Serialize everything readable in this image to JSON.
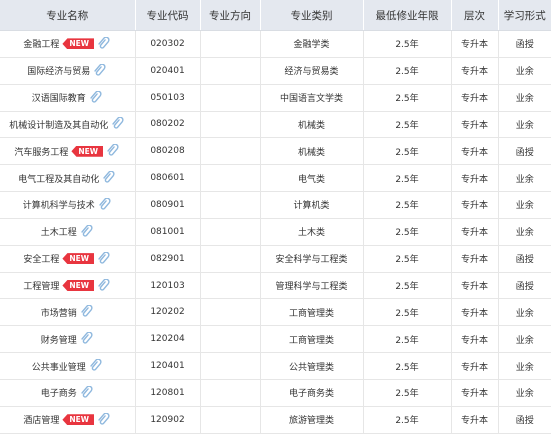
{
  "table": {
    "headers": [
      "专业名称",
      "专业代码",
      "专业方向",
      "专业类别",
      "最低修业年限",
      "层次",
      "学习形式"
    ],
    "new_badge_label": "NEW",
    "rows": [
      {
        "name": "金融工程",
        "is_new": true,
        "code": "020302",
        "direction": "",
        "category": "金融学类",
        "years": "2.5年",
        "level": "专升本",
        "form": "函授"
      },
      {
        "name": "国际经济与贸易",
        "is_new": false,
        "code": "020401",
        "direction": "",
        "category": "经济与贸易类",
        "years": "2.5年",
        "level": "专升本",
        "form": "业余"
      },
      {
        "name": "汉语国际教育",
        "is_new": false,
        "code": "050103",
        "direction": "",
        "category": "中国语言文学类",
        "years": "2.5年",
        "level": "专升本",
        "form": "业余"
      },
      {
        "name": "机械设计制造及其自动化",
        "is_new": false,
        "code": "080202",
        "direction": "",
        "category": "机械类",
        "years": "2.5年",
        "level": "专升本",
        "form": "业余"
      },
      {
        "name": "汽车服务工程",
        "is_new": true,
        "code": "080208",
        "direction": "",
        "category": "机械类",
        "years": "2.5年",
        "level": "专升本",
        "form": "函授"
      },
      {
        "name": "电气工程及其自动化",
        "is_new": false,
        "code": "080601",
        "direction": "",
        "category": "电气类",
        "years": "2.5年",
        "level": "专升本",
        "form": "业余"
      },
      {
        "name": "计算机科学与技术",
        "is_new": false,
        "code": "080901",
        "direction": "",
        "category": "计算机类",
        "years": "2.5年",
        "level": "专升本",
        "form": "业余"
      },
      {
        "name": "土木工程",
        "is_new": false,
        "code": "081001",
        "direction": "",
        "category": "土木类",
        "years": "2.5年",
        "level": "专升本",
        "form": "业余"
      },
      {
        "name": "安全工程",
        "is_new": true,
        "code": "082901",
        "direction": "",
        "category": "安全科学与工程类",
        "years": "2.5年",
        "level": "专升本",
        "form": "函授"
      },
      {
        "name": "工程管理",
        "is_new": true,
        "code": "120103",
        "direction": "",
        "category": "管理科学与工程类",
        "years": "2.5年",
        "level": "专升本",
        "form": "函授"
      },
      {
        "name": "市场营销",
        "is_new": false,
        "code": "120202",
        "direction": "",
        "category": "工商管理类",
        "years": "2.5年",
        "level": "专升本",
        "form": "业余"
      },
      {
        "name": "财务管理",
        "is_new": false,
        "code": "120204",
        "direction": "",
        "category": "工商管理类",
        "years": "2.5年",
        "level": "专升本",
        "form": "业余"
      },
      {
        "name": "公共事业管理",
        "is_new": false,
        "code": "120401",
        "direction": "",
        "category": "公共管理类",
        "years": "2.5年",
        "level": "专升本",
        "form": "业余"
      },
      {
        "name": "电子商务",
        "is_new": false,
        "code": "120801",
        "direction": "",
        "category": "电子商务类",
        "years": "2.5年",
        "level": "专升本",
        "form": "业余"
      },
      {
        "name": "酒店管理",
        "is_new": true,
        "code": "120902",
        "direction": "",
        "category": "旅游管理类",
        "years": "2.5年",
        "level": "专升本",
        "form": "函授"
      }
    ]
  },
  "icons": {
    "attachment": "paperclip-icon"
  },
  "colors": {
    "header_bg": "#e4e8ef",
    "badge_bg": "#e8353f",
    "clip_blue": "#8fb8de",
    "border": "#e6e6e6"
  }
}
